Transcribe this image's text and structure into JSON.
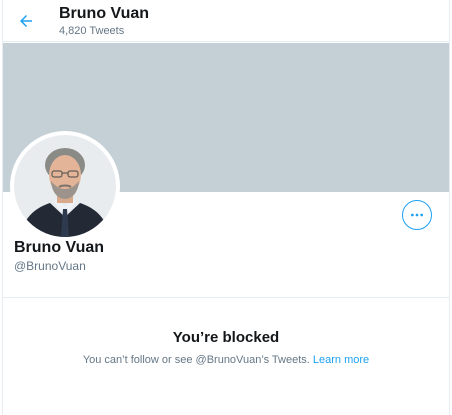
{
  "header": {
    "name": "Bruno Vuan",
    "tweet_count": "4,820 Tweets"
  },
  "profile": {
    "name": "Bruno Vuan",
    "handle": "@BrunoVuan"
  },
  "blocked": {
    "title": "You’re blocked",
    "message": "You can’t follow or see @BrunoVuan’s Tweets.",
    "link": "Learn more"
  },
  "icons": {
    "back": "arrow-left-icon",
    "more": "ellipsis-icon"
  },
  "colors": {
    "accent": "#1da1f2",
    "banner": "#c4cfd6",
    "secondary_text": "#657786",
    "primary_text": "#14171a"
  }
}
